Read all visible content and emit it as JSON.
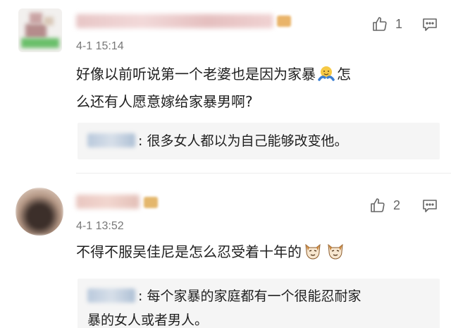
{
  "comments": [
    {
      "time": "4-1 15:14",
      "text_line1": "好像以前听说第一个老婆也是因为家暴",
      "text_line1_end": "怎",
      "text_line2": "么还有人愿意嫁给家暴男啊?",
      "likes": "1",
      "reply": {
        "colon": ":",
        "text": "很多女人都以为自己能够改变他。"
      }
    },
    {
      "time": "4-1 13:52",
      "text": "不得不服吴佳尼是怎么忍受着十年的",
      "likes": "2",
      "reply": {
        "colon": ":",
        "text_line1": "每个家暴的家庭都有一个很能忍耐家",
        "text_line2": "暴的女人或者男人。"
      }
    }
  ],
  "icons": {
    "like": "thumbs-up-icon",
    "reply": "comment-bubble-icon",
    "emoji1": "hugging-face-emoji",
    "emoji2": "cat-face-emoji"
  },
  "colors": {
    "text": "#1f1f1f",
    "meta": "#777777",
    "reply_bg": "#f5f5f5"
  }
}
